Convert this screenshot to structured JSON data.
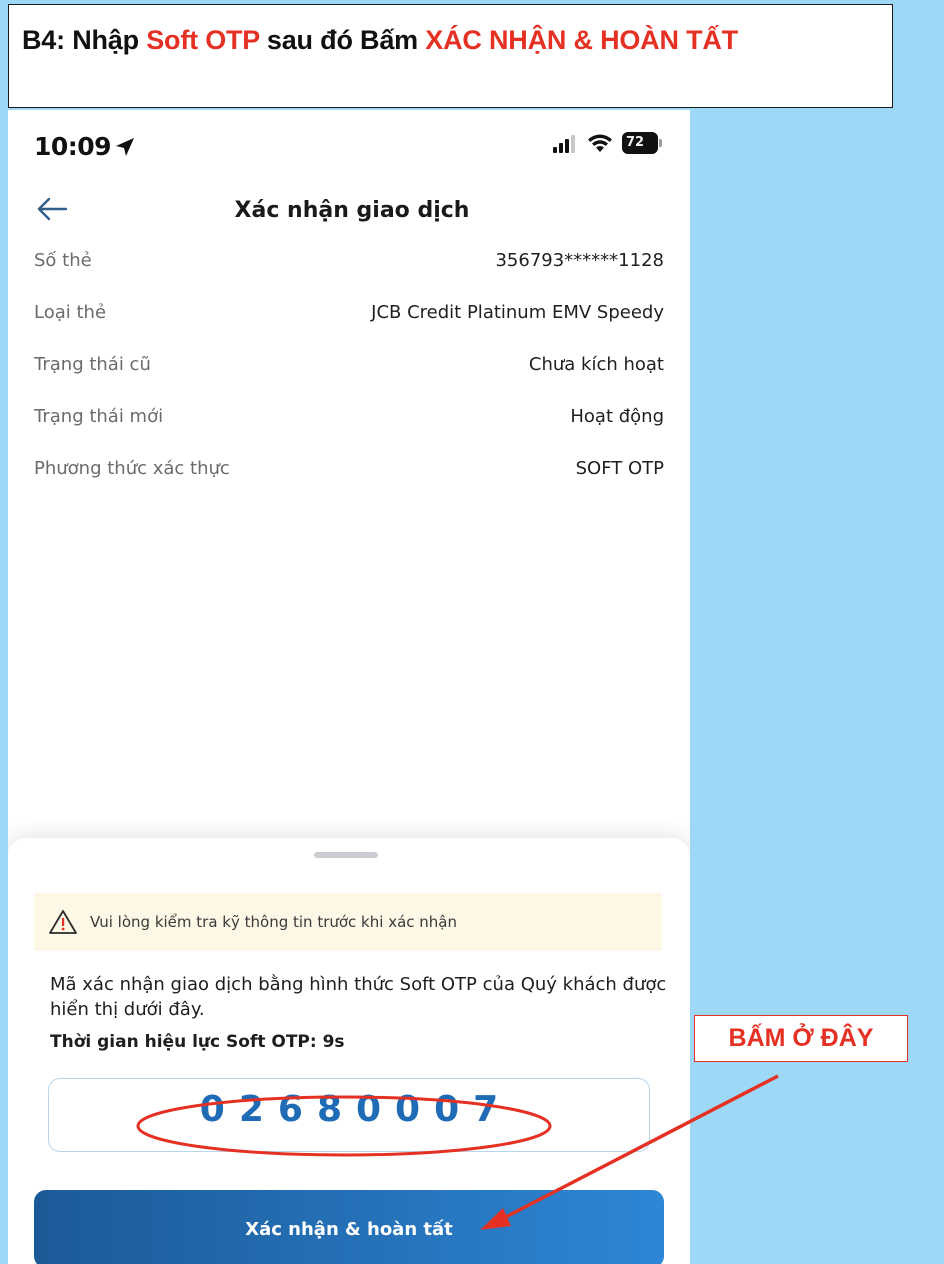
{
  "banner": {
    "prefix": "B4: Nhập ",
    "highlight1": "Soft OTP",
    "middle": " sau đó Bấm ",
    "highlight2": "XÁC NHẬN & HOÀN TẤT"
  },
  "status_bar": {
    "time": "10:09",
    "battery": "72"
  },
  "nav": {
    "title": "Xác nhận giao dịch"
  },
  "details": [
    {
      "label": "Số thẻ",
      "value": "356793******1128"
    },
    {
      "label": "Loại thẻ",
      "value": "JCB Credit Platinum EMV Speedy"
    },
    {
      "label": "Trạng thái cũ",
      "value": "Chưa kích hoạt"
    },
    {
      "label": "Trạng thái mới",
      "value": "Hoạt động"
    },
    {
      "label": "Phương thức xác thực",
      "value": "SOFT OTP"
    }
  ],
  "sheet": {
    "warning": "Vui lòng kiểm tra kỹ thông tin trước khi xác nhận",
    "description": "Mã xác nhận giao dịch bằng hình thức Soft OTP của Quý khách được hiển thị dưới đây.",
    "validity": "Thời gian hiệu lực Soft OTP:  9s",
    "otp": "02680007",
    "confirm_label": "Xác nhận & hoàn tất"
  },
  "callout": {
    "label": "BẤM Ở ĐÂY"
  },
  "colors": {
    "background": "#9dd9f7",
    "accent_red": "#e53124",
    "otp_blue": "#1f6bb5",
    "button_start": "#1b5a97",
    "button_end": "#2e86d6"
  }
}
